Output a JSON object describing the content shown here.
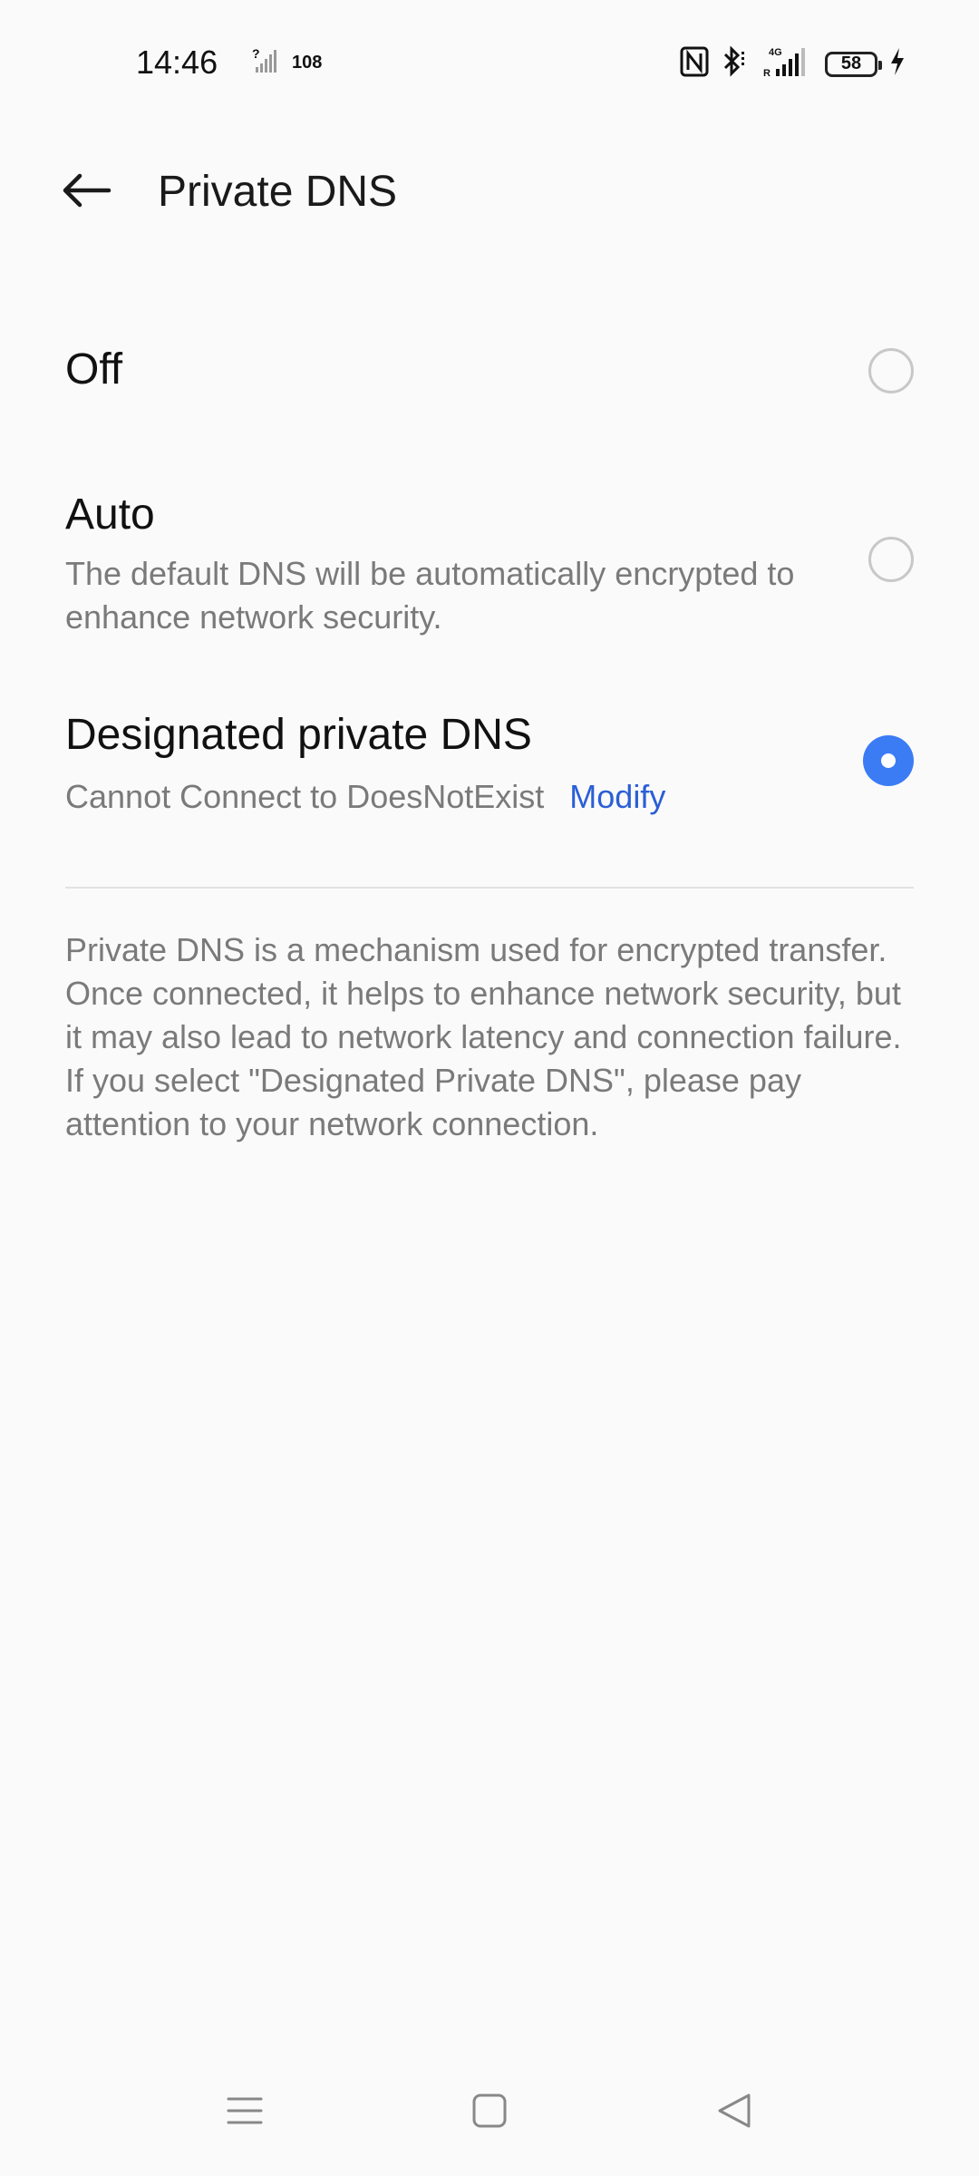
{
  "status_bar": {
    "time": "14:46",
    "net_speed": "108",
    "battery_level": "58",
    "icons": [
      "unknown-signal-icon",
      "nfc-icon",
      "bluetooth-icon",
      "4g-signal-icon",
      "battery-icon",
      "charging-icon"
    ]
  },
  "header": {
    "title": "Private DNS",
    "back_icon": "back-arrow-icon"
  },
  "options": {
    "off": {
      "title": "Off",
      "selected": false
    },
    "auto": {
      "title": "Auto",
      "description": "The default DNS will be automatically encrypted to enhance network security.",
      "selected": false
    },
    "designated": {
      "title": "Designated private DNS",
      "status": "Cannot Connect to DoesNotExist",
      "modify_label": "Modify",
      "selected": true
    }
  },
  "info": {
    "text": "Private DNS is a mechanism used for encrypted transfer. Once connected, it helps to enhance network security, but it may also lead to network latency and connection failure. If you select \"Designated Private DNS\", please pay attention to your network connection."
  },
  "colors": {
    "accent": "#3b7cf5",
    "link": "#2a5fd6",
    "background": "#fafafa",
    "secondary_text": "#7a7a7a"
  },
  "nav_bar": {
    "icons": [
      "menu-icon",
      "home-icon",
      "back-icon"
    ]
  }
}
